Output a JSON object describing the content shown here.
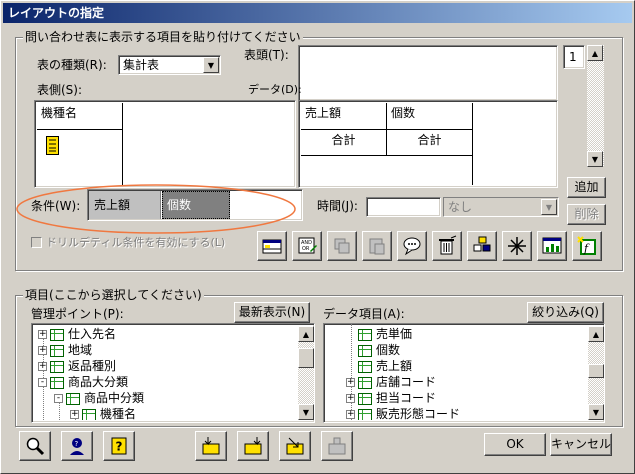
{
  "window": {
    "title": "レイアウトの指定"
  },
  "layout_group": {
    "legend": "問い合わせ表に表示する項目を貼り付けてください",
    "table_type_label": "表の種類(R):",
    "table_type_value": "集計表",
    "header_label": "表頭(T):",
    "side_label": "表側(S):",
    "data_label": "データ(D):",
    "side_item": "機種名",
    "data_columns": [
      "売上額",
      "個数"
    ],
    "data_totals": [
      "合計",
      "合計"
    ],
    "page_number": "1",
    "add_button": "追加",
    "delete_button": "削除",
    "condition_label": "条件(W):",
    "conditions": [
      "売上額",
      "個数"
    ],
    "time_label": "時間(J):",
    "time_value": "",
    "time_range_value": "なし",
    "drilldetail_label": "ドリルデティル条件を有効にする(L)"
  },
  "items_group": {
    "legend": "項目(ここから選択してください)",
    "mgmt_label": "管理ポイント(P):",
    "refresh_button": "最新表示(N)",
    "data_items_label": "データ項目(A):",
    "filter_button": "絞り込み(Q)",
    "mgmt_tree": [
      {
        "label": "仕入先名",
        "level": 0,
        "expander": "+"
      },
      {
        "label": "地域",
        "level": 0,
        "expander": "+"
      },
      {
        "label": "返品種別",
        "level": 0,
        "expander": "+"
      },
      {
        "label": "商品大分類",
        "level": 0,
        "expander": "-"
      },
      {
        "label": "商品中分類",
        "level": 1,
        "expander": "-"
      },
      {
        "label": "機種名",
        "level": 2,
        "expander": "+"
      }
    ],
    "data_tree": [
      {
        "label": "売単価",
        "level": 0,
        "expander": ""
      },
      {
        "label": "個数",
        "level": 0,
        "expander": ""
      },
      {
        "label": "売上額",
        "level": 0,
        "expander": ""
      },
      {
        "label": "店舗コード",
        "level": 0,
        "expander": "+"
      },
      {
        "label": "担当コード",
        "level": 0,
        "expander": "+"
      },
      {
        "label": "販売形態コード",
        "level": 0,
        "expander": "+"
      }
    ]
  },
  "footer": {
    "ok_button": "OK",
    "cancel_button": "キャンセル"
  }
}
